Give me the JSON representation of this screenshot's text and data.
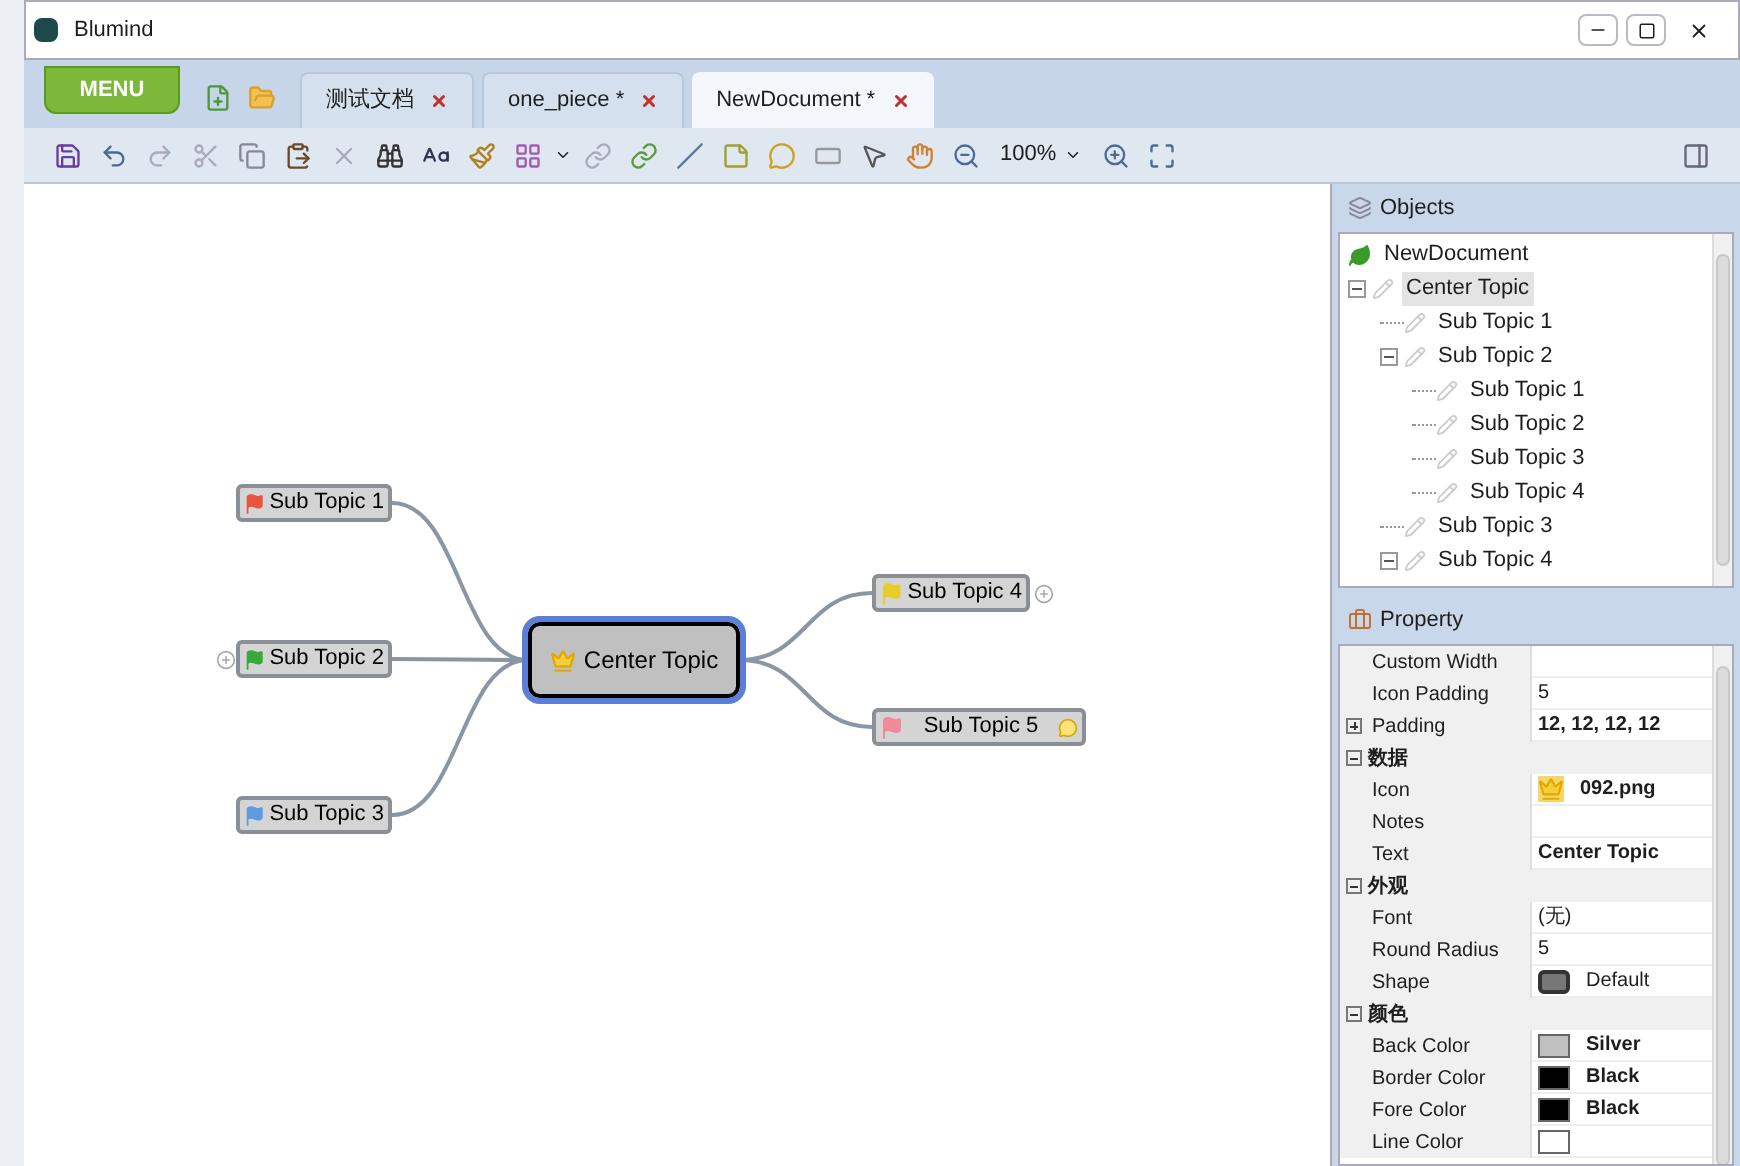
{
  "window": {
    "title": "Blumind"
  },
  "menu_button": "MENU",
  "tabs": [
    {
      "label": "测试文档",
      "selected": false
    },
    {
      "label": "one_piece *",
      "selected": false
    },
    {
      "label": "NewDocument *",
      "selected": true
    }
  ],
  "toolbar": {
    "zoom": "100%"
  },
  "mindmap": {
    "center": {
      "text": "Center Topic",
      "selected": true
    },
    "topics": [
      {
        "text": "Sub Topic 1",
        "color": "#e8553f"
      },
      {
        "text": "Sub Topic 2",
        "color": "#3aa83a",
        "expandable": true
      },
      {
        "text": "Sub Topic 3",
        "color": "#5b9be0"
      },
      {
        "text": "Sub Topic 4",
        "color": "#e8cc2a",
        "expandable": true
      },
      {
        "text": "Sub Topic 5",
        "color": "#f08a9a",
        "note": true
      }
    ]
  },
  "objects": {
    "title": "Objects",
    "tree": [
      {
        "label": "NewDocument",
        "selected": false,
        "children": [
          {
            "label": "Center Topic",
            "selected": true,
            "expanded": true,
            "children": [
              {
                "label": "Sub Topic 1",
                "selected": false
              },
              {
                "label": "Sub Topic 2",
                "selected": false,
                "expanded": true,
                "children": [
                  {
                    "label": "Sub Topic 1",
                    "selected": false
                  },
                  {
                    "label": "Sub Topic 2",
                    "selected": false
                  },
                  {
                    "label": "Sub Topic 3",
                    "selected": false
                  },
                  {
                    "label": "Sub Topic 4",
                    "selected": false
                  }
                ]
              },
              {
                "label": "Sub Topic 3",
                "selected": false
              },
              {
                "label": "Sub Topic 4",
                "selected": false,
                "expanded": true
              }
            ]
          }
        ]
      }
    ]
  },
  "property": {
    "title": "Property",
    "rows": [
      {
        "kind": "property",
        "name": "Custom Width"
      },
      {
        "kind": "property",
        "name": "Icon Padding",
        "value": "5"
      },
      {
        "kind": "property",
        "name": "Padding",
        "value": "12, 12, 12, 12",
        "modified": true,
        "expanded": false
      },
      {
        "kind": "category",
        "name": "数据",
        "expanded": true
      },
      {
        "kind": "icon",
        "name": "Icon",
        "value": "092.png",
        "modified": true
      },
      {
        "kind": "property",
        "name": "Notes"
      },
      {
        "kind": "property",
        "name": "Text",
        "value": "Center Topic",
        "modified": true
      },
      {
        "kind": "category",
        "name": "外观",
        "expanded": true
      },
      {
        "kind": "property",
        "name": "Font",
        "value": "(无)"
      },
      {
        "kind": "property",
        "name": "Round Radius",
        "value": "5"
      },
      {
        "kind": "shape",
        "name": "Shape",
        "value": "Default"
      },
      {
        "kind": "category",
        "name": "颜色",
        "expanded": true
      },
      {
        "kind": "color",
        "name": "Back Color",
        "value": "Silver",
        "modified": true,
        "color": "#c0c0c0"
      },
      {
        "kind": "color",
        "name": "Border Color",
        "value": "Black",
        "modified": true,
        "color": "#000000"
      },
      {
        "kind": "color",
        "name": "Fore Color",
        "value": "Black",
        "modified": true,
        "color": "#000000"
      },
      {
        "kind": "color",
        "name": "Line Color",
        "color": "#ffffff"
      }
    ]
  }
}
